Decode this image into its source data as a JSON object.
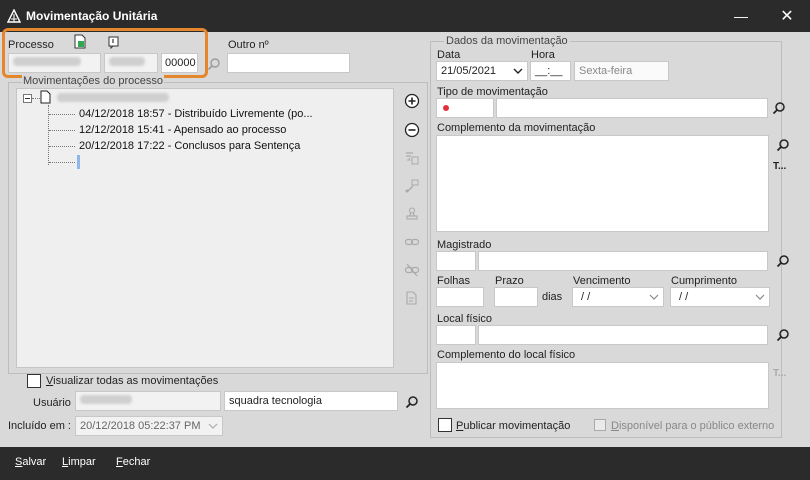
{
  "window": {
    "title": "Movimentação Unitária",
    "minimize_glyph": "—",
    "maximize_glyph": "☐",
    "close_glyph": "✕"
  },
  "processo": {
    "label": "Processo",
    "suffix_value": "00000",
    "outro_label": "Outro nº",
    "outro_value": ""
  },
  "movimentacoes": {
    "legend": "Movimentações do processo",
    "items": [
      {
        "text": "04/12/2018 18:57 - Distribuído Livremente (po..."
      },
      {
        "text": "12/12/2018 15:41 - Apensado ao processo"
      },
      {
        "text": "20/12/2018 17:22 - Conclusos para Sentença"
      }
    ],
    "visualizar_todas_label": "Visualizar todas as movimentações",
    "visualizar_todas_checked": false
  },
  "usuario": {
    "label": "Usuário",
    "name_value": "squadra tecnologia"
  },
  "incluido": {
    "label": "Incluído em :",
    "value": "20/12/2018 05:22:37 PM"
  },
  "dados": {
    "legend": "Dados da movimentação",
    "data_label": "Data",
    "data_value": "21/05/2021",
    "hora_label": "Hora",
    "hora_value": "__:__",
    "weekday_value": "Sexta-feira",
    "tipo_label": "Tipo de movimentação",
    "complemento_label": "Complemento da movimentação",
    "magistrado_label": "Magistrado",
    "folhas_label": "Folhas",
    "prazo_label": "Prazo",
    "dias_label": "dias",
    "vencimento_label": "Vencimento",
    "vencimento_value": "/ /",
    "cumprimento_label": "Cumprimento",
    "cumprimento_value": "/ /",
    "local_label": "Local físico",
    "complemento_local_label": "Complemento do local físico",
    "publicar_label": "Publicar movimentação",
    "publicar_checked": false,
    "disponivel_label": "Disponível para o público externo",
    "disponivel_checked": false,
    "text_format_glyph": "T..."
  },
  "actions": {
    "salvar": "Salvar",
    "limpar": "Limpar",
    "fechar": "Fechar"
  },
  "colors": {
    "titlebar": "#2b2b2b",
    "highlight": "#e4862c",
    "required_dot": "#e0303a",
    "background": "#d9d9d9"
  }
}
